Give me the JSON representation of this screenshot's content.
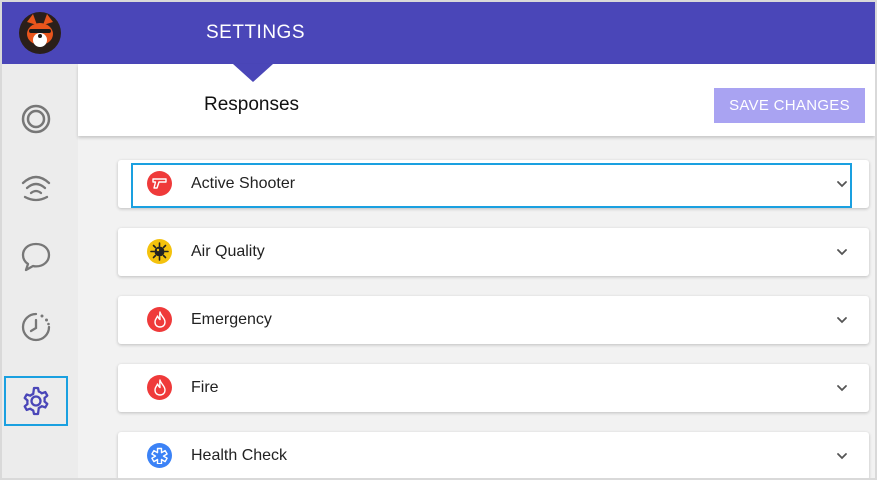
{
  "header": {
    "title": "SETTINGS"
  },
  "subheader": {
    "title": "Responses",
    "save_label": "SAVE CHANGES"
  },
  "sidebar": {
    "items": [
      {
        "name": "rings-icon"
      },
      {
        "name": "broadcast-icon"
      },
      {
        "name": "chat-icon"
      },
      {
        "name": "history-clock-icon"
      },
      {
        "name": "gear-icon",
        "active": true
      }
    ]
  },
  "responses": [
    {
      "label": "Active Shooter",
      "icon": "gun-icon",
      "color": "#ef3a3a"
    },
    {
      "label": "Air Quality",
      "icon": "virus-icon",
      "color": "#f4c20d"
    },
    {
      "label": "Emergency",
      "icon": "flame-icon",
      "color": "#ef3a3a"
    },
    {
      "label": "Fire",
      "icon": "flame-icon",
      "color": "#ef3a3a"
    },
    {
      "label": "Health Check",
      "icon": "medical-star-icon",
      "color": "#3b82f6"
    }
  ],
  "colors": {
    "brand": "#4a46b8",
    "accent": "#a9a3f2",
    "focus": "#1aa0e0"
  }
}
